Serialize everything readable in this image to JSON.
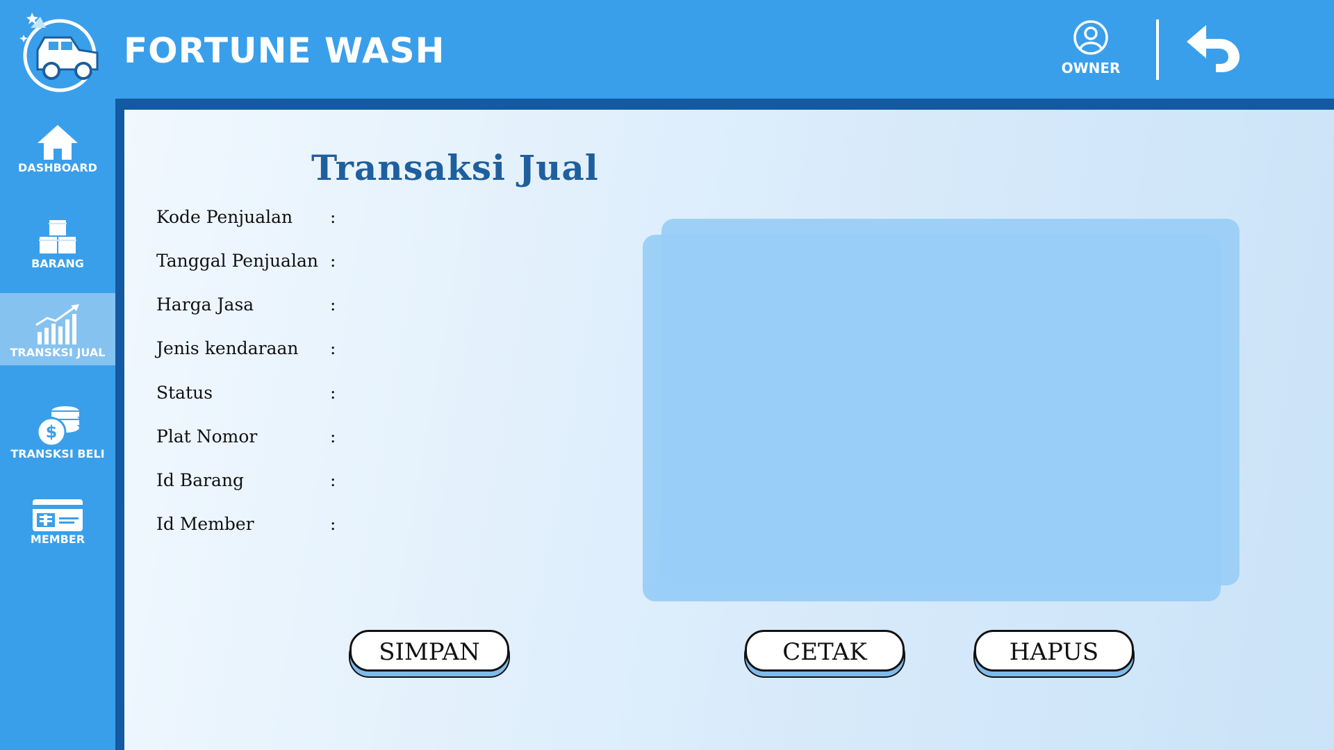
{
  "app": {
    "title": "FORTUNE WASH"
  },
  "header": {
    "user_label": "OWNER",
    "user_icon": "user-circle-icon",
    "back_icon": "back-arrow-icon"
  },
  "sidebar": {
    "items": [
      {
        "label": "DASHBOARD",
        "icon": "home-icon",
        "active": false
      },
      {
        "label": "BARANG",
        "icon": "boxes-icon",
        "active": false
      },
      {
        "label": "TRANSKSI JUAL",
        "icon": "chart-growth-icon",
        "active": true
      },
      {
        "label": "TRANSKSI BELI",
        "icon": "coins-dollar-icon",
        "active": false
      },
      {
        "label": "MEMBER",
        "icon": "member-card-icon",
        "active": false
      }
    ]
  },
  "page": {
    "title": "Transaksi  Jual"
  },
  "form": {
    "fields": [
      {
        "label": "Kode Penjualan",
        "colon": ":"
      },
      {
        "label": "Tanggal Penjualan",
        "colon": ":"
      },
      {
        "label": "Harga Jasa",
        "colon": ":"
      },
      {
        "label": "Jenis kendaraan",
        "colon": ":"
      },
      {
        "label": "Status",
        "colon": ":"
      },
      {
        "label": "Plat Nomor",
        "colon": ":"
      },
      {
        "label": "Id Barang",
        "colon": ":"
      },
      {
        "label": "Id Member",
        "colon": ":"
      }
    ]
  },
  "actions": {
    "save": "SIMPAN",
    "print": "CETAK",
    "delete": "HAPUS"
  },
  "colors": {
    "header_bg": "#3a9fea",
    "frame": "#135aa3",
    "title": "#1f5f9e",
    "active_nav": "#86c2f0",
    "preview": "#98cef7"
  }
}
